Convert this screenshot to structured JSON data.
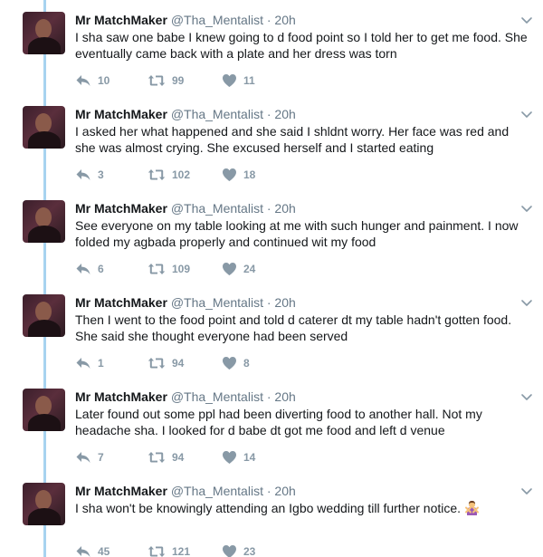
{
  "tweets": [
    {
      "name": "Mr MatchMaker",
      "handle": "@Tha_Mentalist",
      "separator": "·",
      "time": "20h",
      "text": "I sha saw one babe I knew going to d food point so I told her to get me food. She eventually came back with a plate and her dress was torn",
      "replies": "10",
      "retweets": "99",
      "likes": "11"
    },
    {
      "name": "Mr MatchMaker",
      "handle": "@Tha_Mentalist",
      "separator": "·",
      "time": "20h",
      "text": "I asked her what happened and she said I shldnt worry. Her face was red and she was almost crying. She excused herself and I started eating",
      "replies": "3",
      "retweets": "102",
      "likes": "18"
    },
    {
      "name": "Mr MatchMaker",
      "handle": "@Tha_Mentalist",
      "separator": "·",
      "time": "20h",
      "text": "See everyone on my table looking at me with such hunger and painment. I now folded my agbada properly and continued wit my food",
      "replies": "6",
      "retweets": "109",
      "likes": "24"
    },
    {
      "name": "Mr MatchMaker",
      "handle": "@Tha_Mentalist",
      "separator": "·",
      "time": "20h",
      "text": "Then I went to the food point and told d caterer dt my table hadn't gotten food. She said she thought everyone had been served",
      "replies": "1",
      "retweets": "94",
      "likes": "8"
    },
    {
      "name": "Mr MatchMaker",
      "handle": "@Tha_Mentalist",
      "separator": "·",
      "time": "20h",
      "text": "Later found out some ppl had been diverting food to another hall. Not my headache sha. I looked for d babe dt got me food and left d venue",
      "replies": "7",
      "retweets": "94",
      "likes": "14"
    },
    {
      "name": "Mr MatchMaker",
      "handle": "@Tha_Mentalist",
      "separator": "·",
      "time": "20h",
      "text": "I sha won't be knowingly attending an Igbo wedding till further notice.",
      "emoji": "person-gesturing-no-emoji",
      "replies": "45",
      "retweets": "121",
      "likes": "23"
    }
  ],
  "colors": {
    "thread_line": "#a7d3f0",
    "muted": "#657786",
    "action": "#8899a6",
    "text": "#14171a"
  },
  "icons": {
    "reply": "reply-icon",
    "retweet": "retweet-icon",
    "like": "heart-icon",
    "menu": "chevron-down-icon"
  }
}
